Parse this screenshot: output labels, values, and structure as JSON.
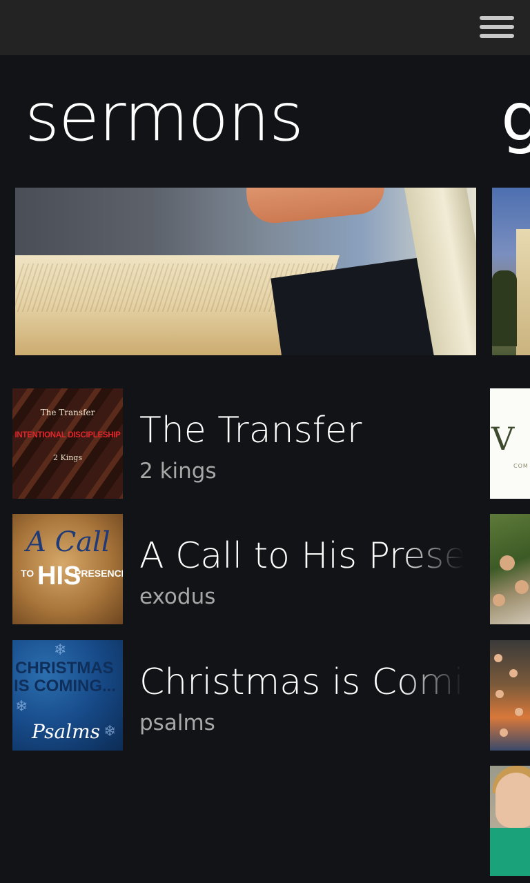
{
  "topbar": {
    "menu_icon": "hamburger-menu-icon"
  },
  "section": {
    "title": "sermons",
    "next_title_peek": "g"
  },
  "hero": {
    "image": "open-bible-photo"
  },
  "sermons": [
    {
      "title": "The Transfer",
      "subtitle": "2 kings",
      "thumb": {
        "line1": "The Transfer",
        "line2": "INTENTIONAL DISCIPLESHIP",
        "line3": "2 Kings"
      }
    },
    {
      "title": "A Call to His Presence",
      "subtitle": "exodus",
      "thumb": {
        "call": "A Call",
        "to": "TO",
        "his": "HIS",
        "presence": "PRESENCE"
      }
    },
    {
      "title": "Christmas is Coming",
      "subtitle": "psalms",
      "thumb": {
        "line1": "CHRISTMAS",
        "line2": "IS COMING...",
        "line3": "Psalms"
      }
    }
  ],
  "right_column": {
    "logo_peek": "V",
    "logo_sub_peek": "COM"
  },
  "colors": {
    "background": "#121316",
    "topbar": "#232323",
    "subtitle": "#a8a8a8",
    "accent_red": "#e0262c"
  }
}
